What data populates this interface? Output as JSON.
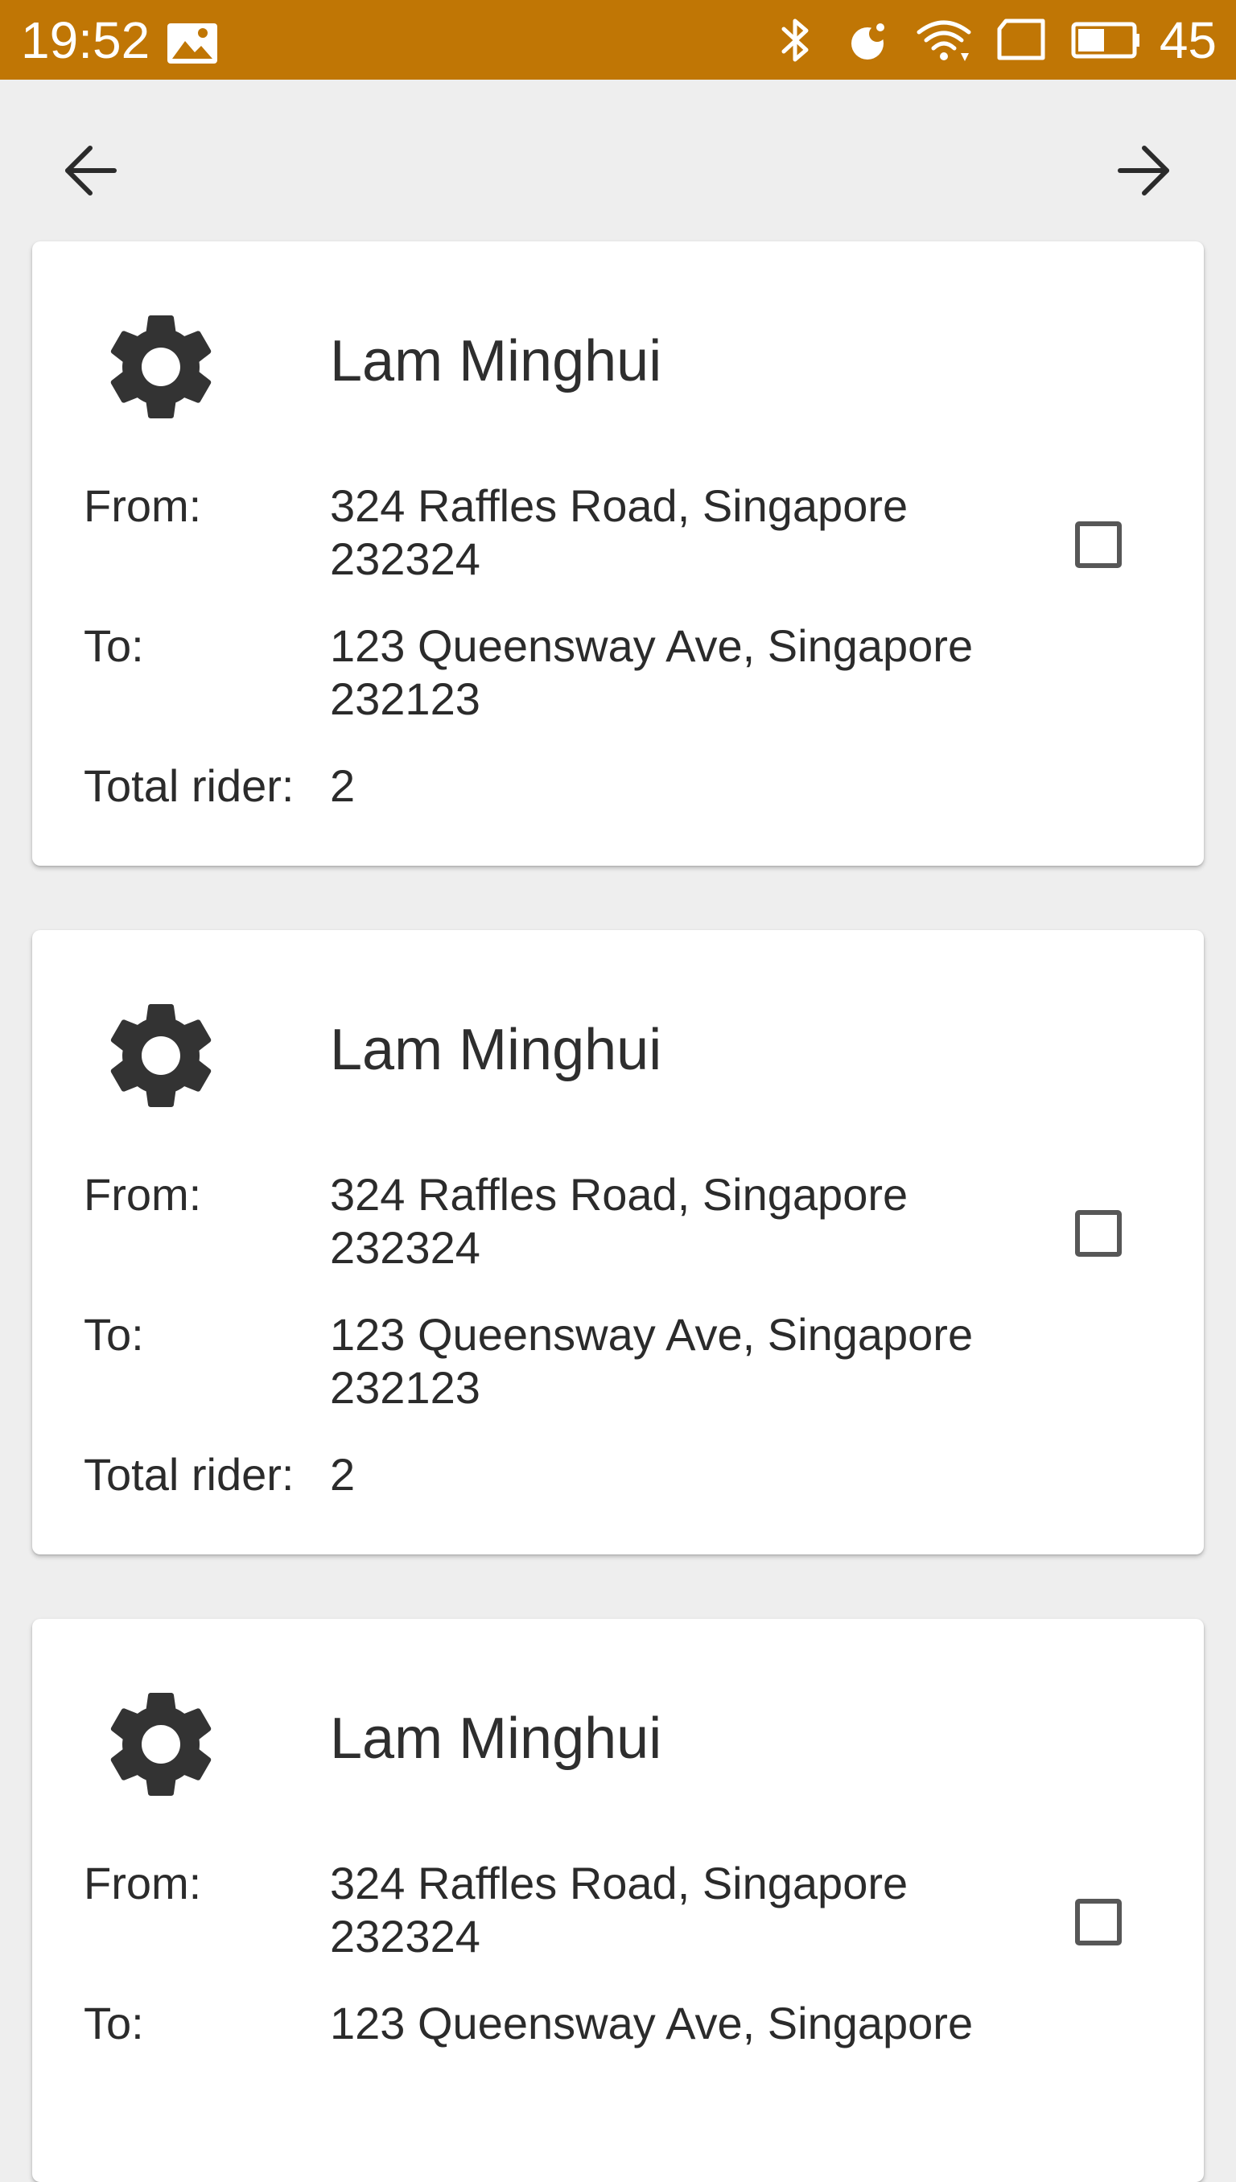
{
  "status_bar": {
    "time": "19:52",
    "battery_level": "45",
    "icons": [
      "image-icon",
      "bluetooth-icon",
      "data-saver-icon",
      "wifi-icon",
      "sim-card-icon",
      "battery-icon"
    ],
    "background_color": "#c07605"
  },
  "navigation": {
    "back_icon": "arrow-left-icon",
    "forward_icon": "arrow-right-icon"
  },
  "labels": {
    "from": "From:",
    "to": "To:",
    "total_rider": "Total rider:"
  },
  "rides": [
    {
      "avatar_icon": "gear-icon",
      "name": "Lam Minghui",
      "from_line1": "324 Raffles Road, Singapore",
      "from_line2": "232324",
      "to_line1": "123 Queensway Ave, Singapore",
      "to_line2": "232123",
      "total_rider": "2",
      "selected": false
    },
    {
      "avatar_icon": "gear-icon",
      "name": "Lam Minghui",
      "from_line1": "324 Raffles Road, Singapore",
      "from_line2": "232324",
      "to_line1": "123 Queensway Ave, Singapore",
      "to_line2": "232123",
      "total_rider": "2",
      "selected": false
    },
    {
      "avatar_icon": "gear-icon",
      "name": "Lam Minghui",
      "from_line1": "324 Raffles Road, Singapore",
      "from_line2": "232324",
      "to_line1": "123 Queensway Ave, Singapore",
      "selected": false
    }
  ]
}
